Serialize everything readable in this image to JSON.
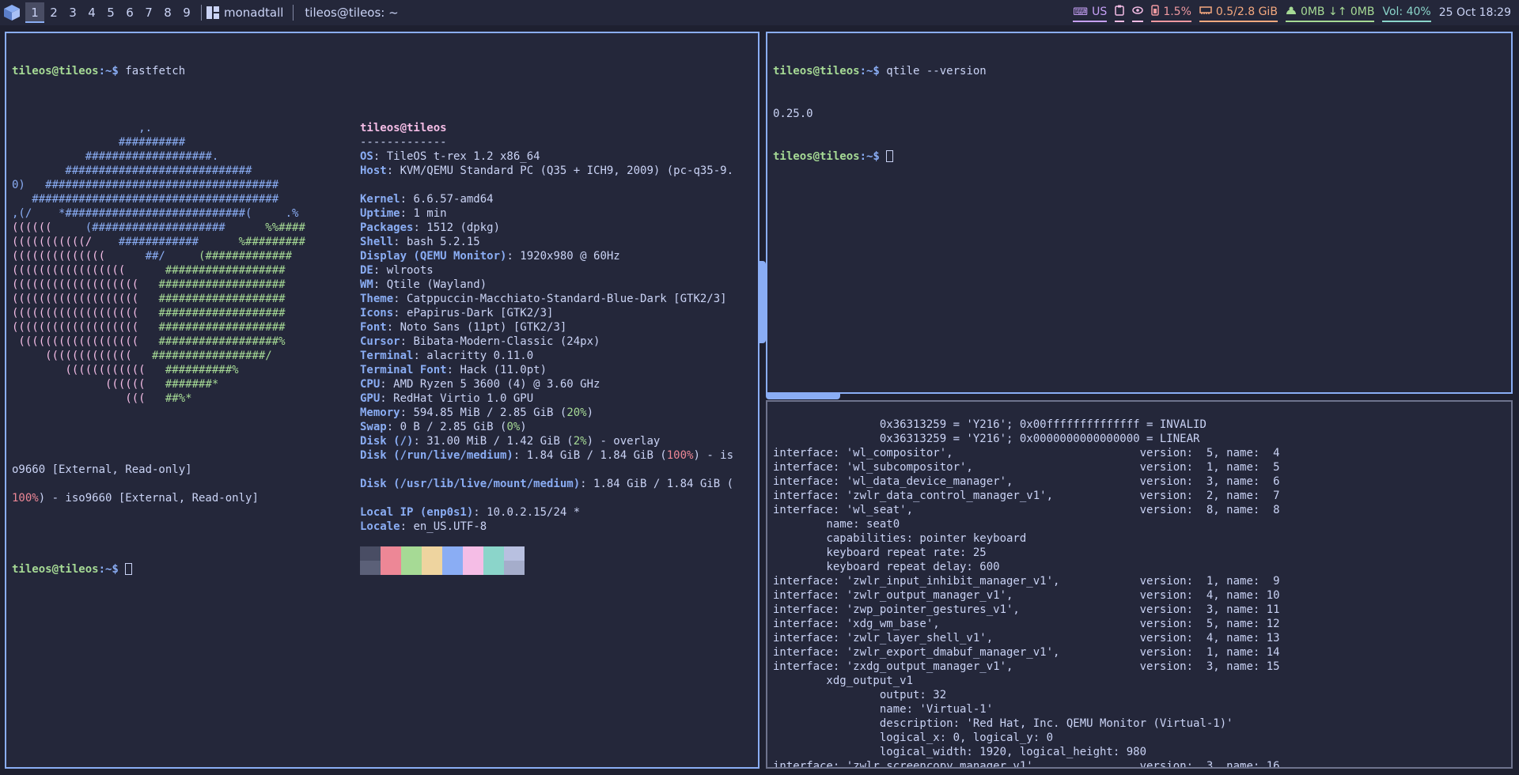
{
  "bar": {
    "groups": [
      "1",
      "2",
      "3",
      "4",
      "5",
      "6",
      "7",
      "8",
      "9"
    ],
    "active_group": "1",
    "layout": "monadtall",
    "window_title": "tileos@tileos: ~",
    "keyboard": "US",
    "cpu": "1.5%",
    "memory": "0.5/2.8 GiB",
    "network": "0MB ↓↑ 0MB",
    "volume": "Vol: 40%",
    "clock": "25 Oct  18:29",
    "colors": {
      "accent": "#8aadf4",
      "bg": "#24273a"
    }
  },
  "left_terminal": {
    "prompt_user": "tileos@tileos",
    "prompt_path": ":~$ ",
    "command": "fastfetch",
    "logo_blue": [
      "                   ,.",
      "                ##########",
      "           ###################.",
      "        ############################",
      "0)   ###################################",
      "   #####################################",
      ",(/    *###########################(     .%"
    ],
    "logo_mixed": [
      [
        "((((((     ",
        "(####################",
        "      %%####"
      ],
      [
        "(((((((((((/    ",
        "############",
        "      %#########"
      ],
      [
        "((((((((((((((      ",
        "##/",
        "     (#############"
      ],
      [
        "(((((((((((((((((      ",
        "",
        "##################"
      ],
      [
        "(((((((((((((((((((   ",
        "",
        "###################"
      ],
      [
        "(((((((((((((((((((   ",
        "",
        "###################"
      ],
      [
        "(((((((((((((((((((   ",
        "",
        "###################"
      ],
      [
        "(((((((((((((((((((   ",
        "",
        "###################"
      ],
      [
        " ((((((((((((((((((   ",
        "",
        "##################%"
      ],
      [
        "     (((((((((((((   ",
        "",
        "#################/"
      ],
      [
        "        ((((((((((((   ",
        "",
        "##########%"
      ],
      [
        "              ((((((   ",
        "",
        "#######*"
      ],
      [
        "                 (((   ",
        "",
        "##%*"
      ]
    ],
    "header_user": "tileos@tileos",
    "header_rule": "-------------",
    "info": [
      {
        "k": "OS",
        "v": "TileOS t-rex 1.2 x86_64"
      },
      {
        "k": "Host",
        "v": "KVM/QEMU Standard PC (Q35 + ICH9, 2009) (pc-q35-9."
      },
      {
        "k": "",
        "v": ""
      },
      {
        "k": "Kernel",
        "v": "6.6.57-amd64"
      },
      {
        "k": "Uptime",
        "v": "1 min"
      },
      {
        "k": "Packages",
        "v": "1512 (dpkg)"
      },
      {
        "k": "Shell",
        "v": "bash 5.2.15"
      },
      {
        "k": "Display (QEMU Monitor)",
        "v": "1920x980 @ 60Hz"
      },
      {
        "k": "DE",
        "v": "wlroots"
      },
      {
        "k": "WM",
        "v": "Qtile (Wayland)"
      },
      {
        "k": "Theme",
        "v": "Catppuccin-Macchiato-Standard-Blue-Dark [GTK2/3]"
      },
      {
        "k": "Icons",
        "v": "ePapirus-Dark [GTK2/3]"
      },
      {
        "k": "Font",
        "v": "Noto Sans (11pt) [GTK2/3]"
      },
      {
        "k": "Cursor",
        "v": "Bibata-Modern-Classic (24px)"
      },
      {
        "k": "Terminal",
        "v": "alacritty 0.11.0"
      },
      {
        "k": "Terminal Font",
        "v": "Hack (11.0pt)"
      },
      {
        "k": "CPU",
        "v": "AMD Ryzen 5 3600 (4) @ 3.60 GHz"
      },
      {
        "k": "GPU",
        "v": "RedHat Virtio 1.0 GPU"
      }
    ],
    "memory_key": "Memory",
    "memory_val": "594.85 MiB / 2.85 GiB (",
    "memory_pct": "20%",
    "swap_key": "Swap",
    "swap_val": "0 B / 2.85 GiB (",
    "swap_pct": "0%",
    "disk1_key": "Disk (/)",
    "disk1_val": "31.00 MiB / 1.42 GiB (",
    "disk1_pct": "2%",
    "disk1_tail": ") - overlay",
    "disk2_key": "Disk (/run/live/medium)",
    "disk2_val": "1.84 GiB / 1.84 GiB (",
    "disk2_pct": "100%",
    "disk2_tail": ") - is",
    "wrap1": "o9660 [External, Read-only]",
    "disk3_key": "Disk (/usr/lib/live/mount/medium)",
    "disk3_val": "1.84 GiB / 1.84 GiB (",
    "wrap2_pct": "100%",
    "wrap2_tail": ") - iso9660 [External, Read-only]",
    "ip_key": "Local IP (enp0s1)",
    "ip_val": "10.0.2.15/24 *",
    "locale_key": "Locale",
    "locale_val": "en_US.UTF-8",
    "palette_top": [
      "#494d64",
      "#ed8796",
      "#a6da95",
      "#eed49f",
      "#8aadf4",
      "#f5bde6",
      "#8bd5ca",
      "#b8c0e0"
    ],
    "palette_bottom": [
      "#5b6078",
      "#ed8796",
      "#a6da95",
      "#eed49f",
      "#8aadf4",
      "#f5bde6",
      "#8bd5ca",
      "#a5adcb"
    ]
  },
  "right_top_terminal": {
    "prompt_user": "tileos@tileos",
    "prompt_path": ":~$ ",
    "command": "qtile --version",
    "output": "0.25.0"
  },
  "right_bottom_terminal": {
    "lines": [
      "                0x36313259 = 'Y216'; 0x00ffffffffffffff = INVALID",
      "                0x36313259 = 'Y216'; 0x0000000000000000 = LINEAR",
      "interface: 'wl_compositor',                            version:  5, name:  4",
      "interface: 'wl_subcompositor',                         version:  1, name:  5",
      "interface: 'wl_data_device_manager',                   version:  3, name:  6",
      "interface: 'zwlr_data_control_manager_v1',             version:  2, name:  7",
      "interface: 'wl_seat',                                  version:  8, name:  8",
      "        name: seat0",
      "        capabilities: pointer keyboard",
      "        keyboard repeat rate: 25",
      "        keyboard repeat delay: 600",
      "interface: 'zwlr_input_inhibit_manager_v1',            version:  1, name:  9",
      "interface: 'zwlr_output_manager_v1',                   version:  4, name: 10",
      "interface: 'zwp_pointer_gestures_v1',                  version:  3, name: 11",
      "interface: 'xdg_wm_base',                              version:  5, name: 12",
      "interface: 'zwlr_layer_shell_v1',                      version:  4, name: 13",
      "interface: 'zwlr_export_dmabuf_manager_v1',            version:  1, name: 14",
      "interface: 'zxdg_output_manager_v1',                   version:  3, name: 15",
      "        xdg_output_v1",
      "                output: 32",
      "                name: 'Virtual-1'",
      "                description: 'Red Hat, Inc. QEMU Monitor (Virtual-1)'",
      "                logical_x: 0, logical_y: 0",
      "                logical_width: 1920, logical_height: 980",
      "interface: 'zwlr_screencopy_manager_v1',               version:  3, name: 16"
    ]
  }
}
